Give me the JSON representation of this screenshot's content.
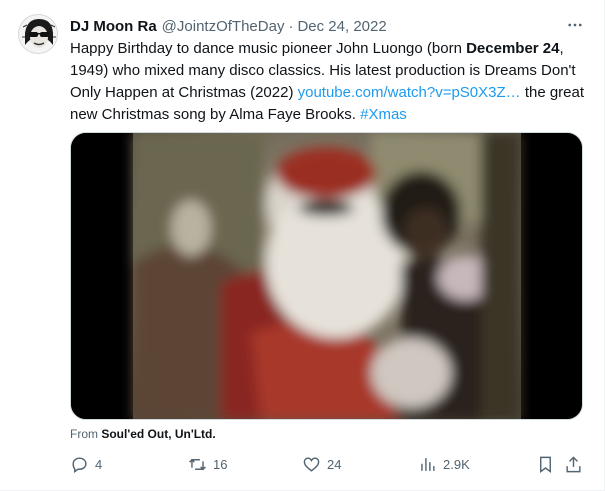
{
  "tweet": {
    "display_name": "DJ Moon Ra",
    "handle": "@JointzOfTheDay",
    "separator": "·",
    "date": "Dec 24, 2022",
    "more_icon": "more-horizontal-icon",
    "text_part1": "Happy Birthday to dance music pioneer John Luongo (born ",
    "text_bold": "December 24",
    "text_part2": ", 1949) who mixed many disco classics. His latest production is Dreams Don't Only Happen at Christmas (2022) ",
    "link": "youtube.com/watch?v=pS0X3Z…",
    "text_part3": " the great new Christmas song by Alma Faye Brooks. ",
    "hashtag": "#Xmas"
  },
  "source": {
    "prefix": "From ",
    "name": "Soul'ed Out, Un'Ltd."
  },
  "actions": {
    "reply": {
      "icon": "reply-icon",
      "count": "4"
    },
    "retweet": {
      "icon": "retweet-icon",
      "count": "16"
    },
    "like": {
      "icon": "heart-icon",
      "count": "24"
    },
    "views": {
      "icon": "views-icon",
      "count": "2.9K"
    },
    "bookmark": {
      "icon": "bookmark-icon"
    },
    "share": {
      "icon": "share-icon"
    }
  },
  "colors": {
    "link": "#1d9bf0",
    "secondary_text": "#536471",
    "primary_text": "#0f1419"
  }
}
